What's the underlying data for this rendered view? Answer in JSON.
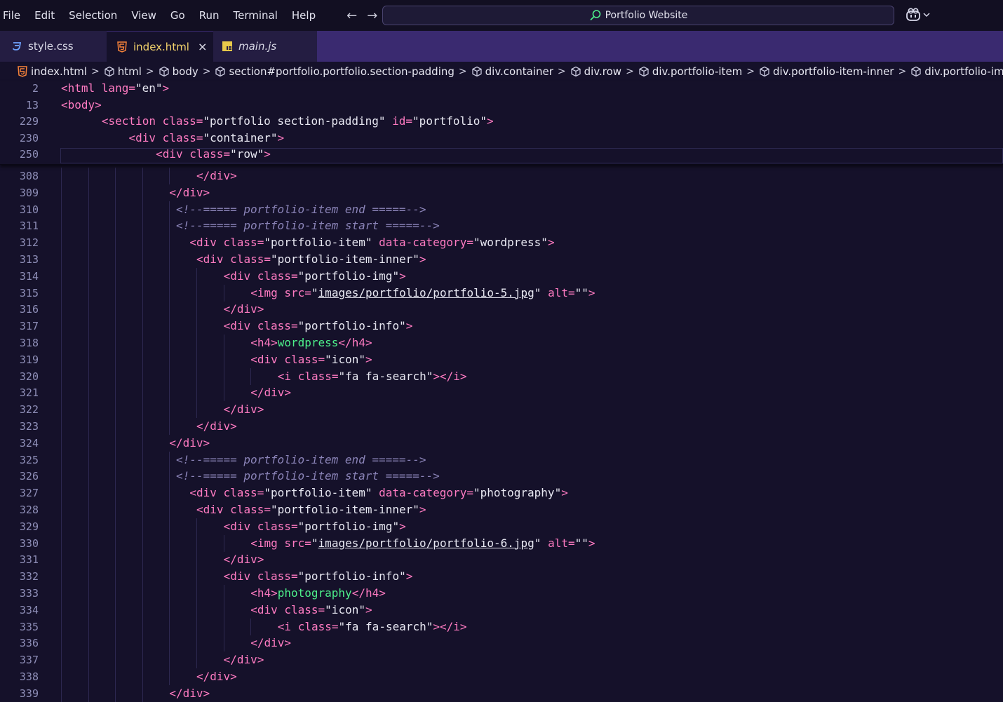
{
  "menu": [
    "File",
    "Edit",
    "Selection",
    "View",
    "Go",
    "Run",
    "Terminal",
    "Help"
  ],
  "search": {
    "label": "Portfolio Website"
  },
  "tabs": [
    {
      "label": "style.css"
    },
    {
      "label": "index.html",
      "close": "×"
    },
    {
      "label": "main.js"
    }
  ],
  "breadcrumb": [
    "index.html",
    "html",
    "body",
    "section#portfolio.portfolio.section-padding",
    "div.container",
    "div.row",
    "div.portfolio-item",
    "div.portfolio-item-inner",
    "div.portfolio-img"
  ],
  "sticky_lines": [
    {
      "n": "2",
      "indent": 0,
      "tokens": [
        [
          "tag",
          "<html "
        ],
        [
          "attr",
          "lang"
        ],
        [
          "tag",
          "="
        ],
        [
          "str",
          "\"en\""
        ],
        [
          "tag",
          ">"
        ]
      ]
    },
    {
      "n": "13",
      "indent": 0,
      "tokens": [
        [
          "tag",
          "<body>"
        ]
      ]
    },
    {
      "n": "229",
      "indent": 6,
      "tokens": [
        [
          "tag",
          "<section "
        ],
        [
          "attr",
          "class"
        ],
        [
          "tag",
          "="
        ],
        [
          "str",
          "\"portfolio section-padding\""
        ],
        [
          "tag",
          " "
        ],
        [
          "attr",
          "id"
        ],
        [
          "tag",
          "="
        ],
        [
          "str",
          "\"portfolio\""
        ],
        [
          "tag",
          ">"
        ]
      ]
    },
    {
      "n": "230",
      "indent": 10,
      "tokens": [
        [
          "tag",
          "<div "
        ],
        [
          "attr",
          "class"
        ],
        [
          "tag",
          "="
        ],
        [
          "str",
          "\"container\""
        ],
        [
          "tag",
          ">"
        ]
      ]
    },
    {
      "n": "250",
      "indent": 14,
      "tokens": [
        [
          "tag",
          "<div "
        ],
        [
          "attr",
          "class"
        ],
        [
          "tag",
          "="
        ],
        [
          "str",
          "\"row\""
        ],
        [
          "tag",
          ">"
        ]
      ]
    }
  ],
  "lines": [
    {
      "n": "308",
      "indent": 20,
      "tokens": [
        [
          "tag",
          "</div>"
        ]
      ]
    },
    {
      "n": "309",
      "indent": 16,
      "tokens": [
        [
          "tag",
          "</div>"
        ]
      ]
    },
    {
      "n": "310",
      "indent": 17,
      "tokens": [
        [
          "cmt",
          "<!--===== portfolio-item end =====-->"
        ]
      ]
    },
    {
      "n": "311",
      "indent": 17,
      "tokens": [
        [
          "cmt",
          "<!--===== portfolio-item start =====-->"
        ]
      ]
    },
    {
      "n": "312",
      "indent": 19,
      "tokens": [
        [
          "tag",
          "<div "
        ],
        [
          "attr",
          "class"
        ],
        [
          "tag",
          "="
        ],
        [
          "str",
          "\"portfolio-item\""
        ],
        [
          "tag",
          " "
        ],
        [
          "attr",
          "data-category"
        ],
        [
          "tag",
          "="
        ],
        [
          "str",
          "\"wordpress\""
        ],
        [
          "tag",
          ">"
        ]
      ]
    },
    {
      "n": "313",
      "indent": 20,
      "tokens": [
        [
          "tag",
          "<div "
        ],
        [
          "attr",
          "class"
        ],
        [
          "tag",
          "="
        ],
        [
          "str",
          "\"portfolio-item-inner\""
        ],
        [
          "tag",
          ">"
        ]
      ]
    },
    {
      "n": "314",
      "indent": 24,
      "tokens": [
        [
          "tag",
          "<div "
        ],
        [
          "attr",
          "class"
        ],
        [
          "tag",
          "="
        ],
        [
          "str",
          "\"portfolio-img\""
        ],
        [
          "tag",
          ">"
        ]
      ]
    },
    {
      "n": "315",
      "indent": 28,
      "tokens": [
        [
          "tag",
          "<img "
        ],
        [
          "attr",
          "src"
        ],
        [
          "tag",
          "="
        ],
        [
          "str",
          "\""
        ],
        [
          "link",
          "images/portfolio/portfolio-5.jpg"
        ],
        [
          "str",
          "\""
        ],
        [
          "tag",
          " "
        ],
        [
          "attr",
          "alt"
        ],
        [
          "tag",
          "="
        ],
        [
          "str",
          "\"\""
        ],
        [
          "tag",
          ">"
        ]
      ]
    },
    {
      "n": "316",
      "indent": 24,
      "tokens": [
        [
          "tag",
          "</div>"
        ]
      ]
    },
    {
      "n": "317",
      "indent": 24,
      "tokens": [
        [
          "tag",
          "<div "
        ],
        [
          "attr",
          "class"
        ],
        [
          "tag",
          "="
        ],
        [
          "str",
          "\"portfolio-info\""
        ],
        [
          "tag",
          ">"
        ]
      ]
    },
    {
      "n": "318",
      "indent": 28,
      "tokens": [
        [
          "tag",
          "<h4>"
        ],
        [
          "txt",
          "wordpress"
        ],
        [
          "tag",
          "</h4>"
        ]
      ]
    },
    {
      "n": "319",
      "indent": 28,
      "tokens": [
        [
          "tag",
          "<div "
        ],
        [
          "attr",
          "class"
        ],
        [
          "tag",
          "="
        ],
        [
          "str",
          "\"icon\""
        ],
        [
          "tag",
          ">"
        ]
      ]
    },
    {
      "n": "320",
      "indent": 32,
      "tokens": [
        [
          "tag",
          "<i "
        ],
        [
          "attr",
          "class"
        ],
        [
          "tag",
          "="
        ],
        [
          "str",
          "\"fa fa-search\""
        ],
        [
          "tag",
          "></i>"
        ]
      ]
    },
    {
      "n": "321",
      "indent": 28,
      "tokens": [
        [
          "tag",
          "</div>"
        ]
      ]
    },
    {
      "n": "322",
      "indent": 24,
      "tokens": [
        [
          "tag",
          "</div>"
        ]
      ]
    },
    {
      "n": "323",
      "indent": 20,
      "tokens": [
        [
          "tag",
          "</div>"
        ]
      ]
    },
    {
      "n": "324",
      "indent": 16,
      "tokens": [
        [
          "tag",
          "</div>"
        ]
      ]
    },
    {
      "n": "325",
      "indent": 17,
      "tokens": [
        [
          "cmt",
          "<!--===== portfolio-item end =====-->"
        ]
      ]
    },
    {
      "n": "326",
      "indent": 17,
      "tokens": [
        [
          "cmt",
          "<!--===== portfolio-item start =====-->"
        ]
      ]
    },
    {
      "n": "327",
      "indent": 19,
      "tokens": [
        [
          "tag",
          "<div "
        ],
        [
          "attr",
          "class"
        ],
        [
          "tag",
          "="
        ],
        [
          "str",
          "\"portfolio-item\""
        ],
        [
          "tag",
          " "
        ],
        [
          "attr",
          "data-category"
        ],
        [
          "tag",
          "="
        ],
        [
          "str",
          "\"photography\""
        ],
        [
          "tag",
          ">"
        ]
      ]
    },
    {
      "n": "328",
      "indent": 20,
      "tokens": [
        [
          "tag",
          "<div "
        ],
        [
          "attr",
          "class"
        ],
        [
          "tag",
          "="
        ],
        [
          "str",
          "\"portfolio-item-inner\""
        ],
        [
          "tag",
          ">"
        ]
      ]
    },
    {
      "n": "329",
      "indent": 24,
      "tokens": [
        [
          "tag",
          "<div "
        ],
        [
          "attr",
          "class"
        ],
        [
          "tag",
          "="
        ],
        [
          "str",
          "\"portfolio-img\""
        ],
        [
          "tag",
          ">"
        ]
      ]
    },
    {
      "n": "330",
      "indent": 28,
      "tokens": [
        [
          "tag",
          "<img "
        ],
        [
          "attr",
          "src"
        ],
        [
          "tag",
          "="
        ],
        [
          "str",
          "\""
        ],
        [
          "link",
          "images/portfolio/portfolio-6.jpg"
        ],
        [
          "str",
          "\""
        ],
        [
          "tag",
          " "
        ],
        [
          "attr",
          "alt"
        ],
        [
          "tag",
          "="
        ],
        [
          "str",
          "\"\""
        ],
        [
          "tag",
          ">"
        ]
      ]
    },
    {
      "n": "331",
      "indent": 24,
      "tokens": [
        [
          "tag",
          "</div>"
        ]
      ]
    },
    {
      "n": "332",
      "indent": 24,
      "tokens": [
        [
          "tag",
          "<div "
        ],
        [
          "attr",
          "class"
        ],
        [
          "tag",
          "="
        ],
        [
          "str",
          "\"portfolio-info\""
        ],
        [
          "tag",
          ">"
        ]
      ]
    },
    {
      "n": "333",
      "indent": 28,
      "tokens": [
        [
          "tag",
          "<h4>"
        ],
        [
          "txt",
          "photography"
        ],
        [
          "tag",
          "</h4>"
        ]
      ]
    },
    {
      "n": "334",
      "indent": 28,
      "tokens": [
        [
          "tag",
          "<div "
        ],
        [
          "attr",
          "class"
        ],
        [
          "tag",
          "="
        ],
        [
          "str",
          "\"icon\""
        ],
        [
          "tag",
          ">"
        ]
      ]
    },
    {
      "n": "335",
      "indent": 32,
      "tokens": [
        [
          "tag",
          "<i "
        ],
        [
          "attr",
          "class"
        ],
        [
          "tag",
          "="
        ],
        [
          "str",
          "\"fa fa-search\""
        ],
        [
          "tag",
          "></i>"
        ]
      ]
    },
    {
      "n": "336",
      "indent": 28,
      "tokens": [
        [
          "tag",
          "</div>"
        ]
      ]
    },
    {
      "n": "337",
      "indent": 24,
      "tokens": [
        [
          "tag",
          "</div>"
        ]
      ]
    },
    {
      "n": "338",
      "indent": 20,
      "tokens": [
        [
          "tag",
          "</div>"
        ]
      ]
    },
    {
      "n": "339",
      "indent": 16,
      "tokens": [
        [
          "tag",
          "</div>"
        ]
      ]
    }
  ],
  "colors": {
    "tag": "#ff7bc2",
    "string": "#e8e8f2",
    "text": "#4df08a",
    "comment": "#8b84b8",
    "line_number": "#8f8fb8",
    "background": "#15112a",
    "tabbar": "#3a2a70"
  },
  "icons": {
    "search": "search-icon",
    "copilot": "copilot-icon",
    "html_file": "html5-icon",
    "css_file": "css3-icon",
    "js_file": "js-icon",
    "breadcrumb_symbol": "cube-icon"
  }
}
